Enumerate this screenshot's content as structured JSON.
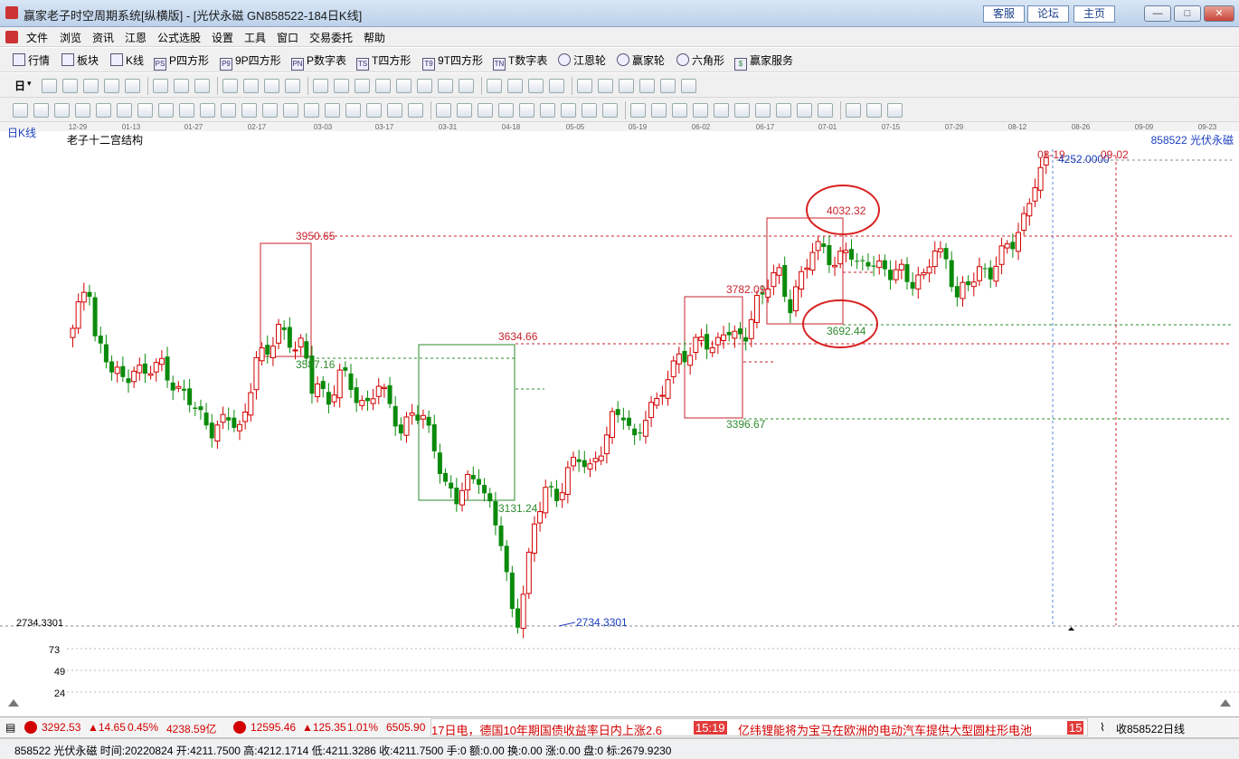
{
  "window": {
    "title": "赢家老子时空周期系统[纵横版] - [光伏永磁  GN858522-184日K线]",
    "links": [
      "客服",
      "论坛",
      "主页"
    ],
    "controls": [
      "—",
      "□",
      "✕"
    ]
  },
  "menu": [
    "文件",
    "浏览",
    "资讯",
    "江恩",
    "公式选股",
    "设置",
    "工具",
    "窗口",
    "交易委托",
    "帮助"
  ],
  "mdi_controls": [
    "_",
    "▫",
    "×"
  ],
  "toolbar1": [
    {
      "label": "行情",
      "icon": "grid-icon"
    },
    {
      "label": "板块",
      "icon": "blocks-icon"
    },
    {
      "label": "K线",
      "icon": "candlestick-icon"
    },
    {
      "label": "P四方形",
      "icon": "ps-icon",
      "badge": "PS"
    },
    {
      "label": "9P四方形",
      "icon": "p9-icon",
      "badge": "P9"
    },
    {
      "label": "P数字表",
      "icon": "pn-icon",
      "badge": "PN"
    },
    {
      "label": "T四方形",
      "icon": "ts-icon",
      "badge": "TS"
    },
    {
      "label": "9T四方形",
      "icon": "t9-icon",
      "badge": "T9"
    },
    {
      "label": "T数字表",
      "icon": "tn-icon",
      "badge": "TN"
    },
    {
      "label": "江恩轮",
      "icon": "gann-wheel-icon"
    },
    {
      "label": "赢家轮",
      "icon": "winner-wheel-icon"
    },
    {
      "label": "六角形",
      "icon": "hexagon-icon"
    },
    {
      "label": "赢家服务",
      "icon": "dollar-icon",
      "badge": "$"
    }
  ],
  "toolbar2_period": "日",
  "chart": {
    "period_label": "日K线",
    "indicator_title": "老子十二宫结构",
    "symbol_label": "858522  光伏永磁",
    "low_axis_label": "2734.3301",
    "sub_axis_labels": [
      "73",
      "49",
      "24"
    ],
    "date_ticks": [
      "12-29",
      "01-13",
      "01-27",
      "02-17",
      "03-03",
      "03-17",
      "03-31",
      "04-18",
      "05-05",
      "05-19",
      "06-02",
      "06-17",
      "07-01",
      "07-15",
      "07-29",
      "08-12",
      "08-26",
      "09-09",
      "09-23"
    ],
    "annotations": {
      "box1_high": "3950.65",
      "box1_low": "3587.16",
      "box2_high": "3634.66",
      "box2_low": "3131.24",
      "low_point": "2734.3301",
      "box3_high": "3782.09",
      "box3_low": "3396.67",
      "box4_high": "4032.32",
      "box4_low": "3692.44",
      "peak_value": "4252.0000",
      "peak_date": "08-19",
      "marker_date": "09-02"
    },
    "colors": {
      "up": "#d20000",
      "down": "#0a8a0a",
      "box_red": "#c8232c",
      "box_green": "#2e8b2e",
      "circle": "#d8201f"
    }
  },
  "status": {
    "sh_index": "3292.53",
    "sh_change": "▲14.65",
    "sh_pct": "0.45%",
    "sh_amount": "4238.59亿",
    "sz_index": "12595.46",
    "sz_change": "▲125.35",
    "sz_pct": "1.01%",
    "sz_amount": "6505.90",
    "ticker_text1": "17日电，德国10年期国债收益率日内上涨2.6",
    "ticker_time1": "15:19",
    "ticker_text2": "亿纬锂能将为宝马在欧洲的电动汽车提供大型圆柱形电池",
    "ticker_time2": "15",
    "right_label": "收858522日线"
  },
  "info": "858522 光伏永磁 时间:20220824 开:4211.7500 高:4212.1714 低:4211.3286 收:4211.7500 手:0 额:0.00 换:0.00 涨:0.00 盘:0 标:2679.9230"
}
